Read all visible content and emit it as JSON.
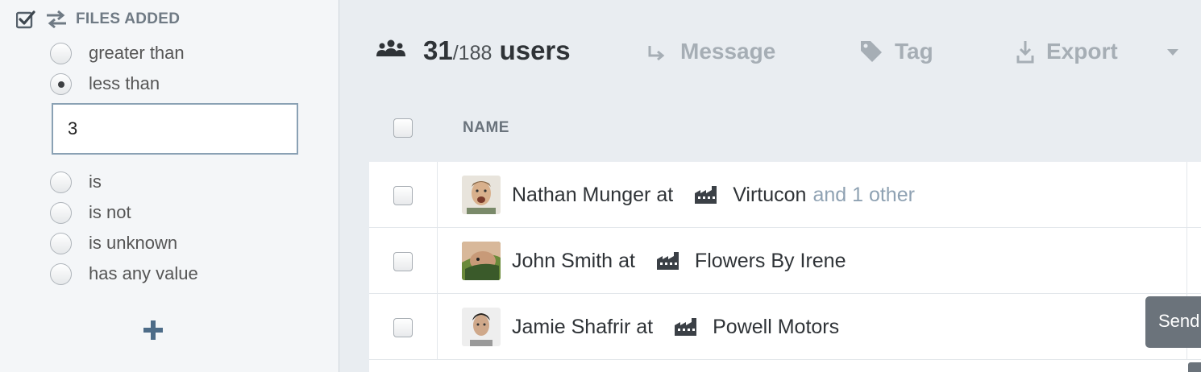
{
  "filter": {
    "title": "FILES ADDED",
    "options": [
      {
        "label": "greater than",
        "selected": false
      },
      {
        "label": "less than",
        "selected": true
      },
      {
        "label": "is",
        "selected": false
      },
      {
        "label": "is not",
        "selected": false
      },
      {
        "label": "is unknown",
        "selected": false
      },
      {
        "label": "has any value",
        "selected": false
      }
    ],
    "value": "3",
    "add_icon": "plus-icon"
  },
  "toolbar": {
    "count": "31",
    "total": "/188",
    "unit": "users",
    "message_label": "Message",
    "tag_label": "Tag",
    "export_label": "Export"
  },
  "table": {
    "column_name": "NAME",
    "rows": [
      {
        "name": "Nathan Munger",
        "at": "at",
        "company": "Virtucon",
        "extra": "and 1 other"
      },
      {
        "name": "John Smith",
        "at": "at",
        "company": "Flowers By Irene",
        "extra": ""
      },
      {
        "name": "Jamie Shafrir",
        "at": "at",
        "company": "Powell Motors",
        "extra": ""
      }
    ]
  },
  "tooltip": {
    "text": "Send"
  },
  "colors": {
    "panel_bg": "#f4f6f8",
    "main_bg": "#e9edf1",
    "muted_action": "#a6aeb5",
    "link_muted": "#8fa2b3",
    "accent_plus": "#4d6c88"
  }
}
